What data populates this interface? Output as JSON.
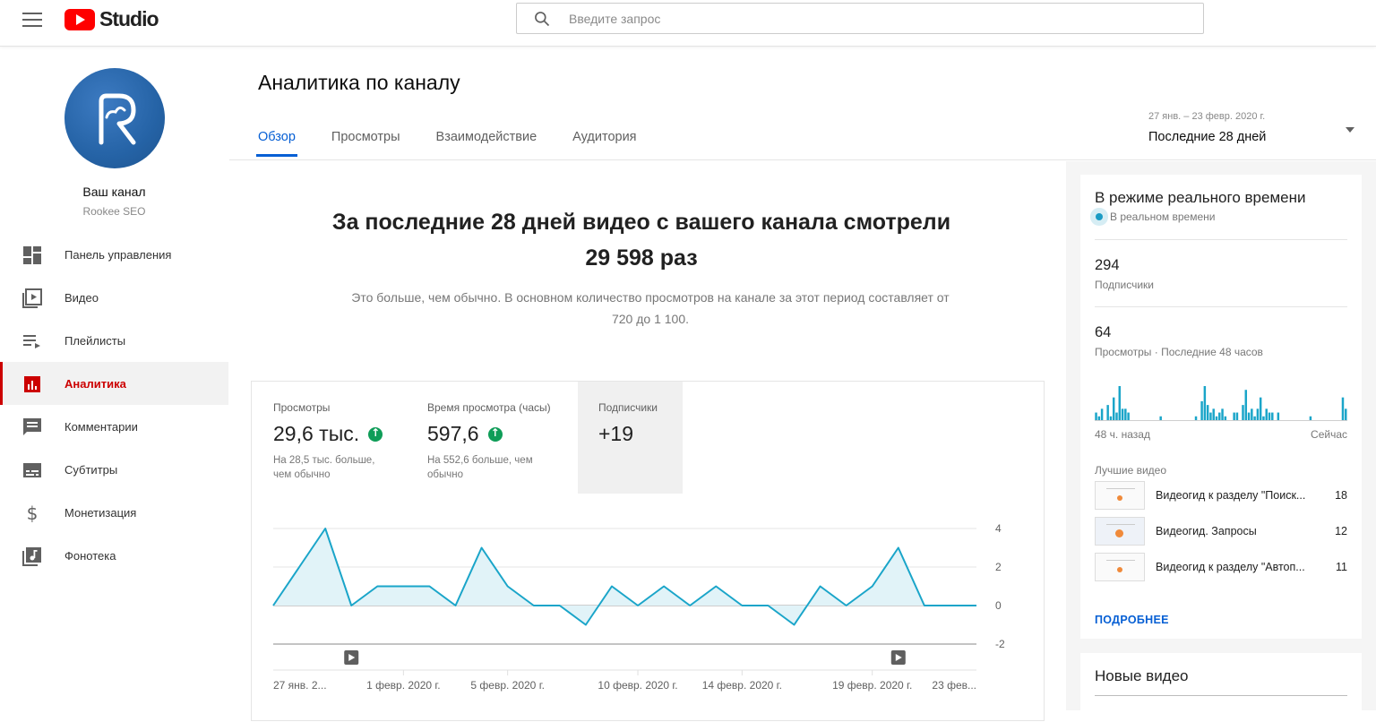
{
  "header": {
    "logo_text": "Studio",
    "search_placeholder": "Введите запрос"
  },
  "channel": {
    "name": "Ваш канал",
    "subtitle": "Rookee SEO"
  },
  "sidebar": {
    "items": [
      {
        "label": "Панель управления",
        "icon": "dashboard-icon"
      },
      {
        "label": "Видео",
        "icon": "video-icon"
      },
      {
        "label": "Плейлисты",
        "icon": "playlist-icon"
      },
      {
        "label": "Аналитика",
        "icon": "analytics-icon",
        "active": true
      },
      {
        "label": "Комментарии",
        "icon": "comments-icon"
      },
      {
        "label": "Субтитры",
        "icon": "subtitles-icon"
      },
      {
        "label": "Монетизация",
        "icon": "dollar-icon"
      },
      {
        "label": "Фонотека",
        "icon": "audio-library-icon"
      }
    ]
  },
  "page": {
    "title": "Аналитика по каналу",
    "tabs": [
      {
        "label": "Обзор",
        "active": true
      },
      {
        "label": "Просмотры"
      },
      {
        "label": "Взаимодействие"
      },
      {
        "label": "Аудитория"
      }
    ],
    "date_range_small": "27 янв. – 23 февр. 2020 г.",
    "date_range_label": "Последние 28 дней"
  },
  "summary": {
    "headline_line1": "За последние 28 дней видео с вашего канала смотрели",
    "headline_line2": "29 598 раз",
    "sub_line1": "Это больше, чем обычно. В основном количество просмотров на канале за этот период составляет от",
    "sub_line2": "720 до 1 100."
  },
  "metrics": [
    {
      "label": "Просмотры",
      "value": "29,6 тыс.",
      "note": "На 28,5 тыс. больше, чем обычно",
      "trend": "up"
    },
    {
      "label": "Время просмотра (часы)",
      "value": "597,6",
      "note": "На 552,6 больше, чем обычно",
      "trend": "up"
    },
    {
      "label": "Подписчики",
      "value": "+19",
      "selected": true
    }
  ],
  "chart_data": {
    "type": "area",
    "x_tick_labels": [
      "27 янв. 2...",
      "1 февр. 2020 г.",
      "5 февр. 2020 г.",
      "10 февр. 2020 г.",
      "14 февр. 2020 г.",
      "19 февр. 2020 г.",
      "23 фев..."
    ],
    "x_tick_days": [
      0,
      5,
      9,
      14,
      18,
      23,
      27
    ],
    "values": [
      0,
      2,
      4,
      0,
      1,
      1,
      1,
      0,
      3,
      1,
      0,
      0,
      -1,
      1,
      0,
      1,
      0,
      1,
      0,
      0,
      -1,
      1,
      0,
      1,
      3,
      0,
      0,
      0
    ],
    "ylim": [
      -2,
      4
    ],
    "y_ticks": [
      "4",
      "2",
      "0",
      "-2"
    ],
    "y_tick_values": [
      4,
      2,
      0,
      -2
    ],
    "video_marker_days": [
      3,
      24
    ],
    "color": "#1aa5c9",
    "fill": "#e1f3f8"
  },
  "realtime": {
    "title": "В режиме реального времени",
    "live_label": "В реальном времени",
    "subscribers_value": "294",
    "subscribers_label": "Подписчики",
    "views_value": "64",
    "views_label": "Просмотры · Последние 48 часов",
    "axis_left": "48 ч. назад",
    "axis_right": "Сейчас",
    "hourly_views": [
      2,
      1,
      3,
      0,
      4,
      1,
      6,
      2,
      9,
      3,
      3,
      2,
      0,
      0,
      0,
      0,
      0,
      0,
      0,
      0,
      0,
      0,
      1,
      0,
      0,
      0,
      0,
      0,
      0,
      0,
      0,
      0,
      0,
      0,
      1,
      0,
      5,
      9,
      4,
      2,
      3,
      1,
      2,
      3,
      1,
      0,
      0,
      2,
      2,
      0,
      4,
      8,
      2,
      3,
      1,
      3,
      6,
      1,
      3,
      2,
      2,
      0,
      2,
      0,
      0,
      0,
      0,
      0,
      0,
      0,
      0,
      0,
      0,
      1,
      0,
      0,
      0,
      0,
      0,
      0,
      0,
      0,
      0,
      0,
      6,
      3
    ],
    "bar_color": "#1aa5c9",
    "best_videos_title": "Лучшие видео",
    "best_videos": [
      {
        "title": "Видеогид к разделу \"Поиск...",
        "count": "18"
      },
      {
        "title": "Видеогид. Запросы",
        "count": "12"
      },
      {
        "title": "Видеогид к разделу \"Автоп...",
        "count": "11"
      }
    ],
    "more_label": "ПОДРОБНЕЕ"
  },
  "new_videos": {
    "title": "Новые видео"
  }
}
